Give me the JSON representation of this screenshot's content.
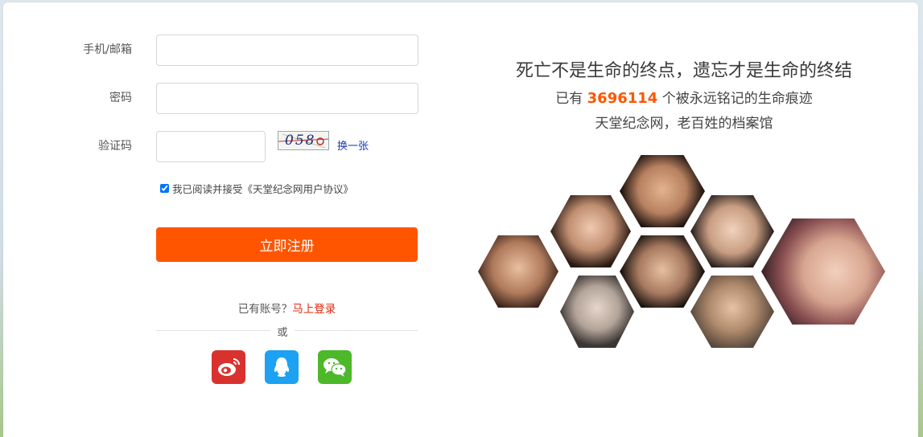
{
  "form": {
    "phone_label": "手机/邮箱",
    "password_label": "密码",
    "captcha_label": "验证码",
    "captcha_text": "058",
    "refresh_label": "换一张",
    "agree_text": "我已阅读并接受《天堂纪念网用户协议》",
    "agree_checked": true,
    "submit_label": "立即注册",
    "have_account_text": "已有账号？",
    "login_link": "马上登录",
    "or_text": "或"
  },
  "social": [
    {
      "name": "weibo",
      "color": "#d9322e"
    },
    {
      "name": "qq",
      "color": "#1da1f2"
    },
    {
      "name": "wechat",
      "color": "#4cb82a"
    }
  ],
  "promo": {
    "headline": "死亡不是生命的终点，遗忘才是生命的终结",
    "count_prefix": "已有",
    "count": "3696114",
    "count_suffix": "个被永远铭记的生命痕迹",
    "tagline": "天堂纪念网，老百姓的档案馆"
  },
  "colors": {
    "accent": "#ff5500",
    "link": "#e1250c"
  }
}
